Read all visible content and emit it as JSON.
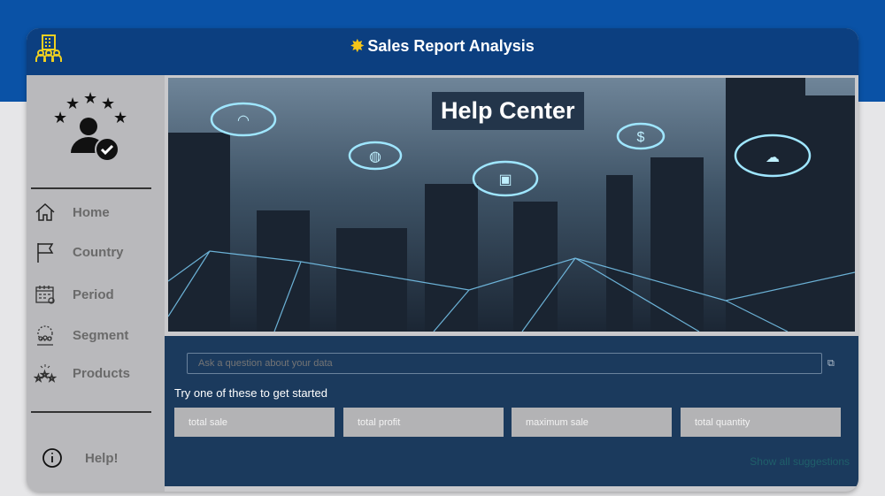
{
  "header": {
    "title": "Sales Report Analysis"
  },
  "sidebar": {
    "items": [
      {
        "label": "Home"
      },
      {
        "label": "Country"
      },
      {
        "label": "Period"
      },
      {
        "label": "Segment"
      },
      {
        "label": "Products"
      }
    ],
    "help": "Help!"
  },
  "hero": {
    "title": "Help Center"
  },
  "qa": {
    "placeholder": "Ask a question about your data",
    "prompt": "Try one of these to get started",
    "suggestions": [
      "total sale",
      "total profit",
      "maximum sale",
      "total quantity"
    ],
    "show_all": "Show all suggestions"
  }
}
